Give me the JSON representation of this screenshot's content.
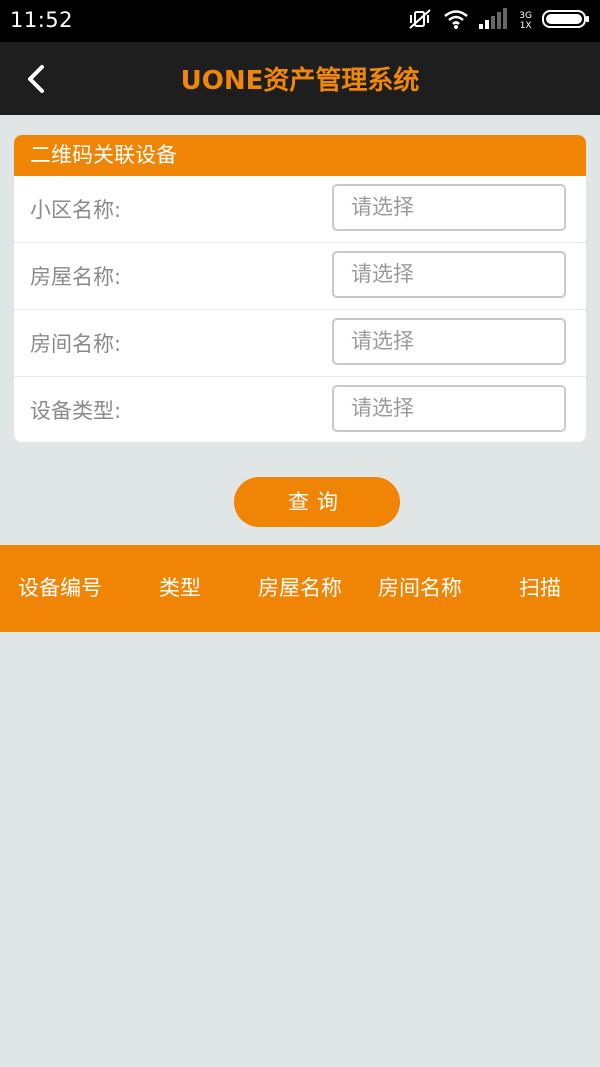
{
  "status_bar": {
    "time": "11:52",
    "network_top": "3G",
    "network_bottom": "1X",
    "icons": [
      "mute-vibrate-icon",
      "wifi-icon",
      "signal-icon",
      "battery-icon"
    ]
  },
  "app_bar": {
    "title": "UONE资产管理系统",
    "back_icon": "chevron-left-icon"
  },
  "form": {
    "header": "二维码关联设备",
    "rows": [
      {
        "label": "小区名称:",
        "placeholder": "请选择"
      },
      {
        "label": "房屋名称:",
        "placeholder": "请选择"
      },
      {
        "label": "房间名称:",
        "placeholder": "请选择"
      },
      {
        "label": "设备类型:",
        "placeholder": "请选择"
      }
    ]
  },
  "query_button": "查询",
  "table": {
    "columns": [
      "设备编号",
      "类型",
      "房屋名称",
      "房间名称",
      "扫描"
    ],
    "rows": []
  },
  "colors": {
    "accent": "#f08405",
    "app_bar": "#1e1e1e",
    "background": "#e0e5e5"
  }
}
